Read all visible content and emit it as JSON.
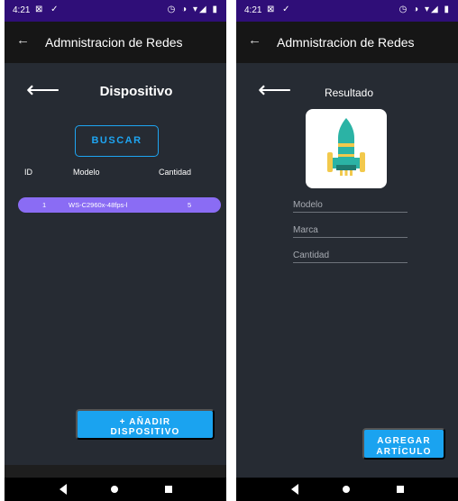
{
  "status_bar": {
    "time": "4:21",
    "left_icons": "⊠ ✓",
    "right_icons": "◷ ◑ ▾◢ ▮"
  },
  "app_bar": {
    "back": "←",
    "title": "Admnistracion de Redes"
  },
  "left_screen": {
    "back_arrow": "⟵",
    "title": "Dispositivo",
    "search_button": "BUSCAR",
    "table": {
      "headers": [
        "ID",
        "Modelo",
        "Cantidad"
      ],
      "rows": [
        {
          "id": "1",
          "modelo": "WS-C2960x-48fps-l",
          "cantidad": "5"
        }
      ]
    },
    "add_button": {
      "line1": "+ AÑADIR",
      "line2": "DISPOSITIVO"
    }
  },
  "right_screen": {
    "back_arrow": "⟵",
    "title": "Resultado",
    "image_icon": "rocket-icon",
    "fields": [
      {
        "placeholder": "Modelo"
      },
      {
        "placeholder": "Marca"
      },
      {
        "placeholder": "Cantidad"
      }
    ],
    "add_button": {
      "line1": "AGREGAR",
      "line2": "ARTÍCULO"
    }
  },
  "nav_bar": {
    "icons": [
      "back-icon",
      "home-icon",
      "recents-icon"
    ]
  },
  "colors": {
    "status_bar": "#2f0e78",
    "app_bar": "#161616",
    "background": "#262b33",
    "accent_blue": "#1aa3f0",
    "row_purple": "#8a6cf4"
  }
}
